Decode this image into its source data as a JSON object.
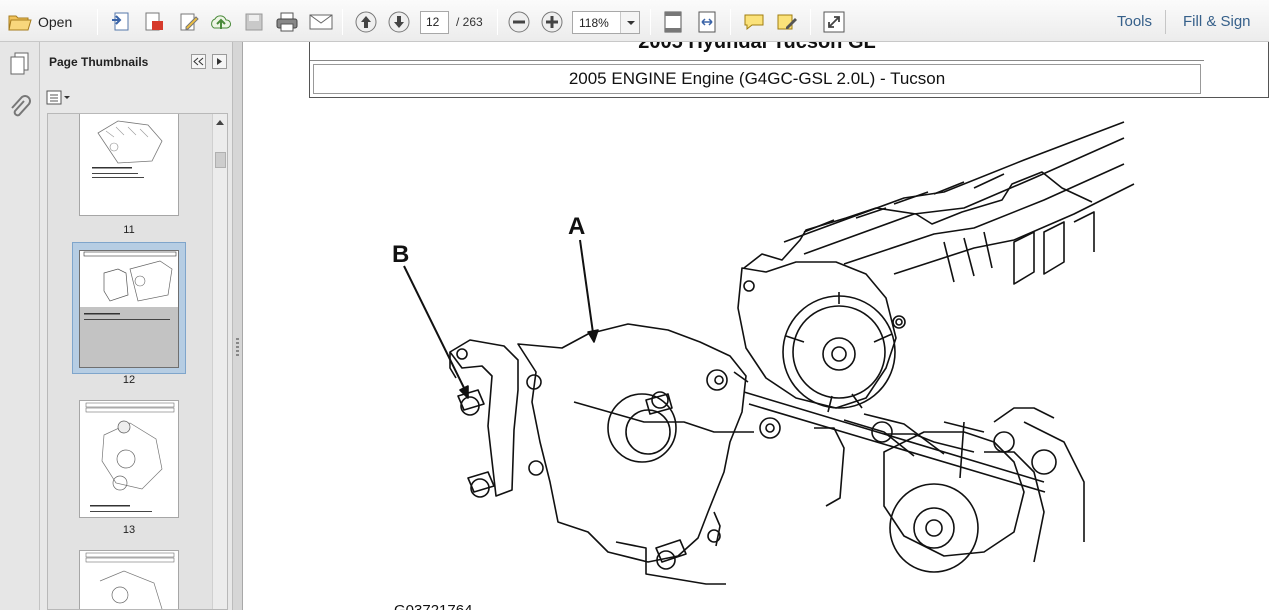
{
  "toolbar": {
    "open_label": "Open",
    "page_current": "12",
    "page_total": "/ 263",
    "zoom": "118%",
    "tools_label": "Tools",
    "fill_sign_label": "Fill & Sign",
    "icons": [
      "open-folder-icon",
      "create-pdf-icon",
      "export-pdf-icon",
      "edit-icon",
      "upload-cloud-icon",
      "save-icon",
      "print-icon",
      "email-icon",
      "prev-page-icon",
      "next-page-icon",
      "zoom-out-icon",
      "zoom-in-icon",
      "fit-page-icon",
      "fit-width-icon",
      "comment-icon",
      "highlight-icon",
      "fullscreen-icon"
    ]
  },
  "sidebar": {
    "title": "Page Thumbnails",
    "thumbnails": [
      {
        "label": "11"
      },
      {
        "label": "12",
        "selected": true
      },
      {
        "label": "13"
      },
      {
        "label": ""
      }
    ]
  },
  "document": {
    "title": "2005 Hyundai Tucson GL",
    "subtitle": "2005 ENGINE Engine (G4GC-GSL 2.0L) - Tucson",
    "callout_a": "A",
    "callout_b": "B",
    "figure_id": "G03721764"
  }
}
